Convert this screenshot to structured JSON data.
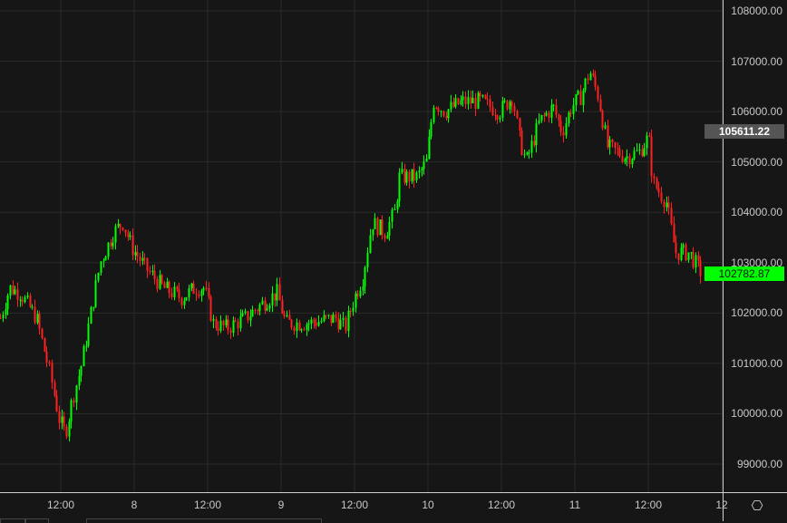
{
  "chart_data": {
    "type": "candlestick",
    "title": "",
    "y_ticks": [
      "108000.00",
      "107000.00",
      "106000.00",
      "105000.00",
      "104000.00",
      "103000.00",
      "102000.00",
      "101000.00",
      "100000.00",
      "99000.00"
    ],
    "ylim": [
      98700,
      108200
    ],
    "x_ticks": [
      {
        "label": "12:00",
        "hour": 12
      },
      {
        "label": "8",
        "hour": 24
      },
      {
        "label": "12:00",
        "hour": 36
      },
      {
        "label": "9",
        "hour": 48
      },
      {
        "label": "12:00",
        "hour": 60
      },
      {
        "label": "10",
        "hour": 72
      },
      {
        "label": "12:00",
        "hour": 84
      },
      {
        "label": "11",
        "hour": 96
      },
      {
        "label": "12:00",
        "hour": 108
      },
      {
        "label": "12",
        "hour": 120
      }
    ],
    "xlim_hours": [
      2.07,
      120
    ],
    "grid": true,
    "price_path": [
      [
        2.1,
        101900
      ],
      [
        3.6,
        102500
      ],
      [
        5.3,
        102400
      ],
      [
        8,
        101900
      ],
      [
        10.2,
        100800
      ],
      [
        11.7,
        99900
      ],
      [
        12.7,
        99600
      ],
      [
        13.9,
        100300
      ],
      [
        15.4,
        101000
      ],
      [
        16.9,
        102000
      ],
      [
        18.4,
        103000
      ],
      [
        20.6,
        103600
      ],
      [
        22.1,
        103800
      ],
      [
        23.6,
        103300
      ],
      [
        25.8,
        102900
      ],
      [
        28.7,
        102500
      ],
      [
        31.7,
        102300
      ],
      [
        33.9,
        102500
      ],
      [
        35.4,
        102500
      ],
      [
        36.9,
        101800
      ],
      [
        39.1,
        101700
      ],
      [
        42.1,
        101900
      ],
      [
        45,
        102200
      ],
      [
        47.3,
        102400
      ],
      [
        48.7,
        101800
      ],
      [
        52.4,
        101800
      ],
      [
        56.9,
        101900
      ],
      [
        58.4,
        101700
      ],
      [
        59.9,
        102300
      ],
      [
        61.3,
        102700
      ],
      [
        62.8,
        103800
      ],
      [
        65,
        103600
      ],
      [
        66.5,
        104000
      ],
      [
        67.3,
        104700
      ],
      [
        70.2,
        104700
      ],
      [
        71.7,
        105000
      ],
      [
        72.9,
        106200
      ],
      [
        74.7,
        106000
      ],
      [
        77.6,
        106200
      ],
      [
        80.6,
        106200
      ],
      [
        83.6,
        106000
      ],
      [
        85.8,
        106300
      ],
      [
        86.8,
        105500
      ],
      [
        88,
        105000
      ],
      [
        90.2,
        105800
      ],
      [
        92.4,
        106100
      ],
      [
        93.9,
        105600
      ],
      [
        95.4,
        106100
      ],
      [
        96.9,
        106300
      ],
      [
        98.4,
        106800
      ],
      [
        99.8,
        106300
      ],
      [
        101.3,
        105300
      ],
      [
        104.3,
        105100
      ],
      [
        106.5,
        105200
      ],
      [
        108,
        105500
      ],
      [
        108.7,
        104600
      ],
      [
        110.9,
        104200
      ],
      [
        112.4,
        103200
      ],
      [
        114.6,
        103200
      ],
      [
        116.6,
        102800
      ]
    ],
    "up_color": "#00ff00",
    "down_color": "#ff2020"
  },
  "price_labels": {
    "crosshair": "105611.22",
    "crosshair_value": 105611.22,
    "last": "102782.87",
    "last_value": 102782.87
  },
  "icons": {
    "settings": "gear-icon"
  }
}
